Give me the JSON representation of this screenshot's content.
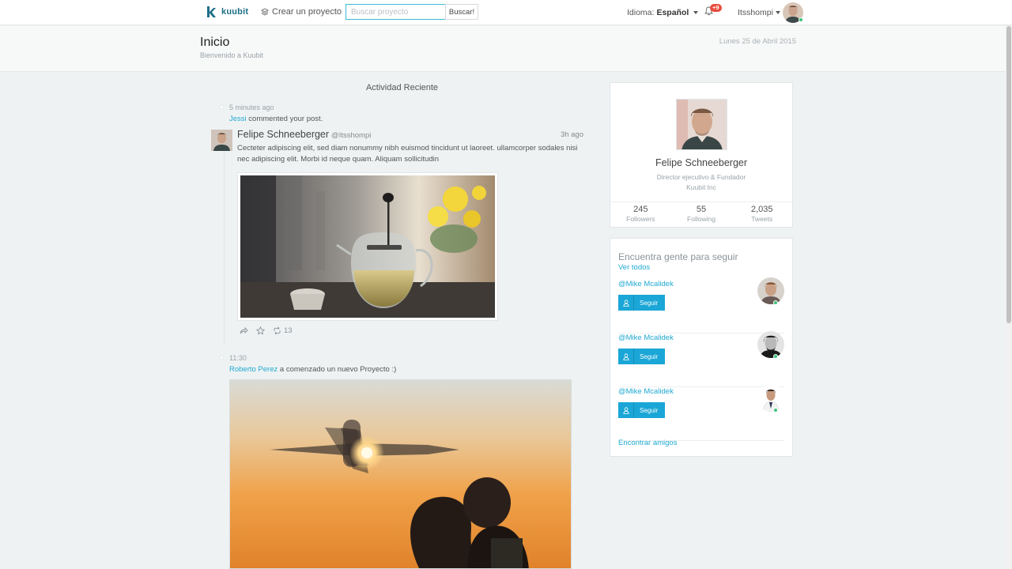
{
  "navbar": {
    "logo_text": "kuubit",
    "create_project": "Crear un proyecto",
    "search_placeholder": "Buscar proyecto",
    "search_button": "Buscar!",
    "language_label": "Idioma:",
    "language_value": "Español",
    "notifications_badge": "+9",
    "username": "Itsshompi"
  },
  "header": {
    "title": "Inicio",
    "subtitle": "Bienvenido a Kuubit",
    "date": "Lunes 25 de Abril 2015"
  },
  "feed": {
    "title": "Actividad Reciente",
    "items": [
      {
        "time": "5 minutes ago",
        "actor": "Jessi",
        "action": "commented your post.",
        "post": {
          "author": "Felipe Schneeberger",
          "handle": "@Itsshompi",
          "time": "3h ago",
          "body": "Cecteter adipiscing elit, sed diam nonummy nibh euismod tincidunt ut laoreet. ullamcorper sodales nisi nec adipiscing elit. Morbi id neque quam. Aliquam sollicitudin",
          "retweets": "13"
        }
      },
      {
        "time": "11:30",
        "actor": "Roberto Perez",
        "action": "a comenzado un nuevo Proyecto :)"
      }
    ]
  },
  "profile": {
    "name": "Felipe Schneeberger",
    "role": "Director ejecutivo & Fundador",
    "company": "Kuubit Inc",
    "stats": [
      {
        "value": "245",
        "label": "Followers"
      },
      {
        "value": "55",
        "label": "Following"
      },
      {
        "value": "2,035",
        "label": "Tweets"
      }
    ]
  },
  "follow": {
    "title": "Encuentra gente para seguir",
    "see_all": "Ver todos",
    "people": [
      {
        "handle": "@Mike Mcalidek",
        "button": "Seguir"
      },
      {
        "handle": "@Mike Mcalidek",
        "button": "Seguir"
      },
      {
        "handle": "@Mike Mcalidek",
        "button": "Seguir"
      }
    ],
    "find_friends": "Encontrar amigos"
  },
  "colors": {
    "accent": "#1fa9d1",
    "button": "#1aa6d6",
    "badge": "#e74c3c",
    "online": "#3cc47c"
  },
  "icons": [
    "kuubit-logo-icon",
    "layers-icon",
    "bell-icon",
    "caret-down-icon",
    "share-icon",
    "star-icon",
    "retweet-icon",
    "user-icon"
  ]
}
